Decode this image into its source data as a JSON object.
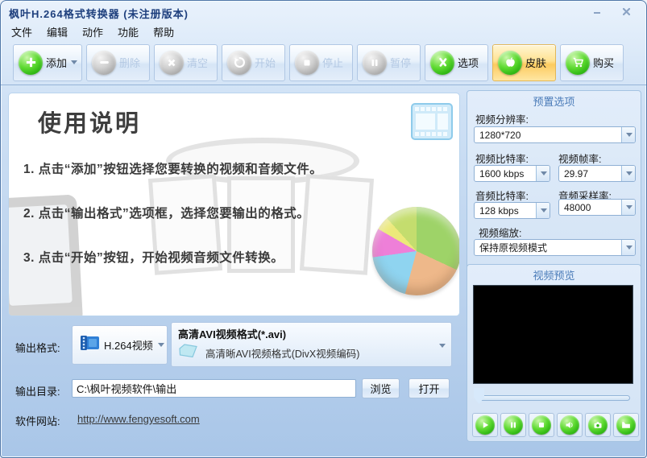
{
  "window": {
    "title": "枫叶H.264格式转换器  (未注册版本)"
  },
  "menu": {
    "items": [
      "文件",
      "编辑",
      "动作",
      "功能",
      "帮助"
    ]
  },
  "toolbar": {
    "buttons": [
      {
        "label": "添加",
        "icon": "add-icon",
        "state": "enabled",
        "has_dropdown": true
      },
      {
        "label": "删除",
        "icon": "remove-icon",
        "state": "disabled"
      },
      {
        "label": "清空",
        "icon": "clear-icon",
        "state": "disabled"
      },
      {
        "label": "开始",
        "icon": "start-icon",
        "state": "disabled"
      },
      {
        "label": "停止",
        "icon": "stop-icon",
        "state": "disabled"
      },
      {
        "label": "暂停",
        "icon": "pause-icon",
        "state": "disabled"
      },
      {
        "label": "选项",
        "icon": "options-icon",
        "state": "enabled"
      },
      {
        "label": "皮肤",
        "icon": "skin-icon",
        "state": "highlighted"
      },
      {
        "label": "购买",
        "icon": "buy-icon",
        "state": "enabled"
      }
    ]
  },
  "instructions": {
    "heading": "使用说明",
    "steps": [
      "1. 点击“添加”按钮选择您要转换的视频和音频文件。",
      "2. 点击“输出格式”选项框，选择您要输出的格式。",
      "3. 点击“开始”按钮，开始视频音频文件转换。"
    ]
  },
  "preset_panel": {
    "title": "预置选项",
    "resolution_label": "视频分辨率:",
    "resolution_value": "1280*720",
    "video_bitrate_label": "视频比特率:",
    "video_bitrate_value": "1600 kbps",
    "frame_rate_label": "视频帧率:",
    "frame_rate_value": "29.97",
    "audio_bitrate_label": "音频比特率:",
    "audio_bitrate_value": "128 kbps",
    "sample_rate_label": "音频采样率:",
    "sample_rate_value": "48000",
    "scaling_label": "视频缩放:",
    "scaling_value": "保持原视频模式"
  },
  "preview_panel": {
    "title": "视频预览",
    "player_buttons": [
      "play",
      "pause",
      "stop",
      "volume",
      "snapshot",
      "open-folder"
    ]
  },
  "output": {
    "format_label": "输出格式:",
    "format_value": "H.264视频",
    "profile_title": "高清AVI视频格式(*.avi)",
    "profile_desc": "高清晰AVI视频格式(DivX视频编码)",
    "dir_label": "输出目录:",
    "dir_value": "C:\\枫叶视频软件\\输出",
    "browse_label": "浏览",
    "open_label": "打开",
    "website_label": "软件网站:",
    "website_url": "http://www.fengyesoft.com"
  },
  "colors": {
    "accent_green": "#2db512",
    "skin_highlight": "#fccb60",
    "panel_title_blue": "#4b7cb9",
    "window_blue": "#bcd3ee",
    "title_text": "#1d3f7d"
  }
}
